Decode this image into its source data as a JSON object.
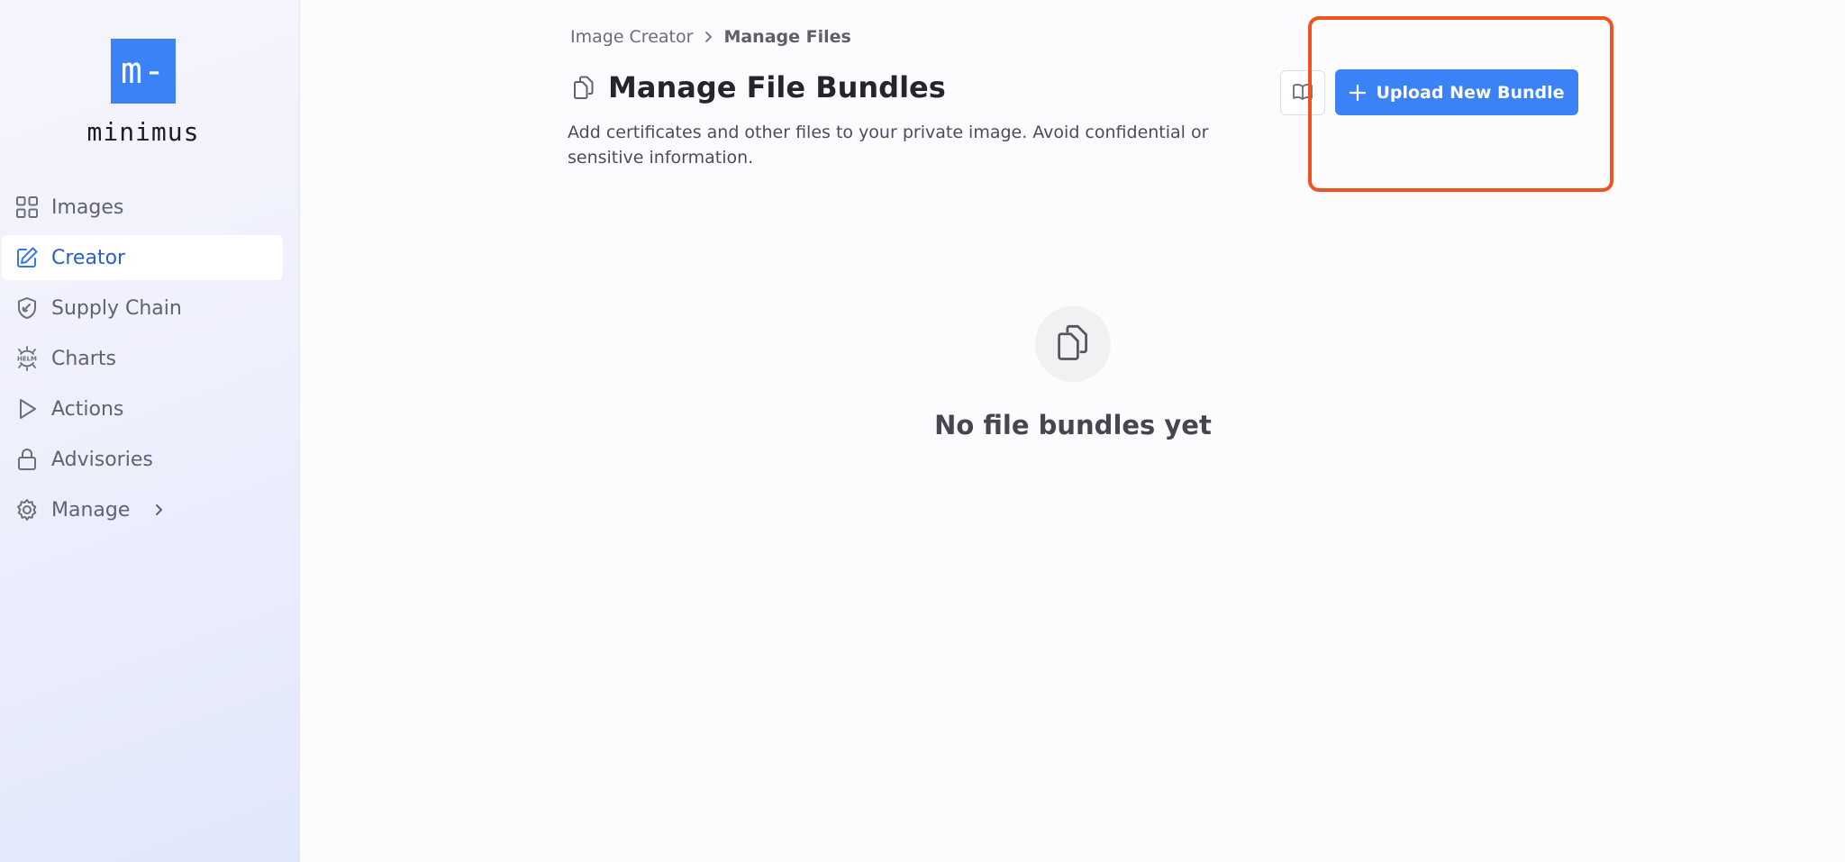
{
  "app": {
    "logo_mark": "m-",
    "logo_text": "minimus"
  },
  "sidebar": {
    "items": [
      {
        "label": "Images",
        "icon": "grid-icon"
      },
      {
        "label": "Creator",
        "icon": "edit-icon",
        "active": true
      },
      {
        "label": "Supply Chain",
        "icon": "shield-link-icon"
      },
      {
        "label": "Charts",
        "icon": "helm-icon"
      },
      {
        "label": "Actions",
        "icon": "play-icon"
      },
      {
        "label": "Advisories",
        "icon": "lock-icon"
      },
      {
        "label": "Manage",
        "icon": "gear-icon",
        "expandable": true
      }
    ]
  },
  "breadcrumb": {
    "parent": "Image Creator",
    "current": "Manage Files"
  },
  "page": {
    "title": "Manage File Bundles",
    "subtitle": "Add certificates and other files to your private image. Avoid confidential or sensitive information."
  },
  "toolbar": {
    "upload_label": "Upload New Bundle",
    "docs_icon": "book-icon"
  },
  "empty_state": {
    "message": "No file bundles yet",
    "icon": "files-icon"
  },
  "colors": {
    "accent": "#3b82f6",
    "active_nav_text": "#2c5ccf",
    "highlight_border": "#f0531f"
  }
}
